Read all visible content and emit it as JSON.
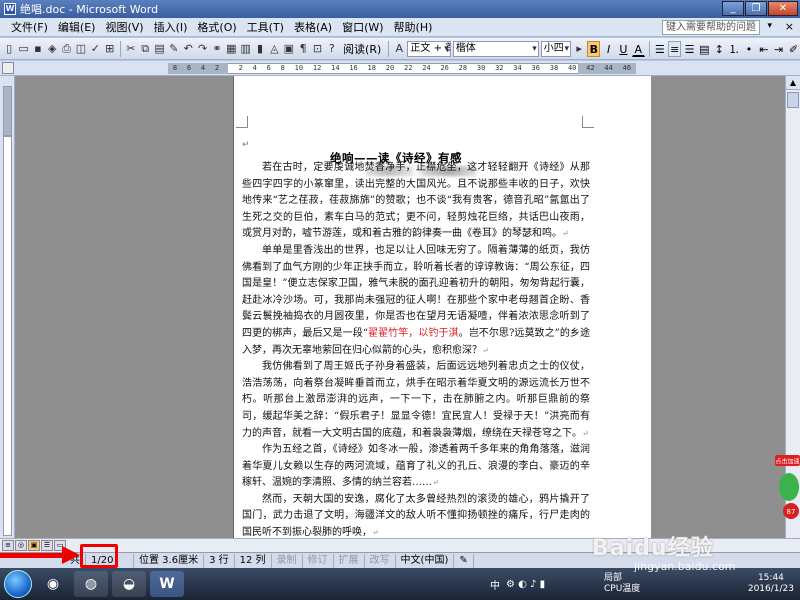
{
  "window": {
    "title": "绝唱.doc - Microsoft Word",
    "app_icon": "W",
    "controls": [
      "minimize",
      "maximize",
      "close"
    ]
  },
  "menubar": {
    "items": [
      "文件(F)",
      "编辑(E)",
      "视图(V)",
      "插入(I)",
      "格式(O)",
      "工具(T)",
      "表格(A)",
      "窗口(W)",
      "帮助(H)"
    ],
    "help_placeholder": "键入需要帮助的问题",
    "close_glyph": "×"
  },
  "toolbar": {
    "read_label": "阅读(R)",
    "style_value": "正文 + 首行",
    "font_value": "楷体",
    "size_value": "小四",
    "bold": "B",
    "italic": "I",
    "underline": "U",
    "font_color_letter": "A"
  },
  "ruler": {
    "numbers": [
      "8",
      "6",
      "4",
      "2",
      "",
      "2",
      "4",
      "6",
      "8",
      "10",
      "12",
      "14",
      "16",
      "18",
      "20",
      "22",
      "24",
      "26",
      "28",
      "30",
      "32",
      "34",
      "36",
      "38",
      "40",
      "42",
      "44",
      "46"
    ]
  },
  "document": {
    "title": "绝响——读《诗经》有感",
    "paragraphs": [
      {
        "runs": [
          {
            "t": "若在古时，定要虔诚地焚香净手，正襟危坐，这才轻轻翻开《诗经》从那些四字四字的小篆窜里，读出完整的大国风光。且不说那些丰收的日子，欢快地传来“艺之荏菽，荏菽旆旆”的赞歌；也不谈“我有贵客，德音孔昭”氤氲出了生死之交的巨伯，素车白马的范式；更不问，轻剪烛花巨络，共话巴山夜雨，或赏月对酌，嘘节游莲，或和着古雅的韵律奏一曲《卷耳》的琴瑟和鸣。"
          }
        ]
      },
      {
        "runs": [
          {
            "t": "单单是里香浅出的世界，也足以让人回味无穷了。隔着薄薄的纸页，我仿佛看到了血气方刚的少年正挟手而立，聆听着长者的谆谆教诲：“周公东征，四国是皇！”便立志保家卫国，雅气未脱的面孔迎着初升的朝阳，匆匆背起行囊，赶赴冰冷沙场。可，我那尚未强冠的征人啊！在那些个家中老母翘首企盼、香鬓云鬟挽袖捣衣的月圆夜里，你是否也在望月无语凝噎，伴着浓浓思念听到了四更的梆声，最后又是一段“"
          },
          {
            "t": "翟翟竹竿，以钓于淇",
            "red": true
          },
          {
            "t": "。岂不尔思?远莫致之”的乡途入梦，再次无辜地萦回在归心似箭的心头，愈积愈深？"
          }
        ]
      },
      {
        "runs": [
          {
            "t": "我仿佛看到了周王姬氏子孙身着盛装，后面远远地列着忠贞之士的仪仗，浩浩荡荡，向着祭台凝眸垂首而立，烘手在昭示着华夏文明的源远流长万世不朽。听那台上激昂澎湃的远声，一下一下，击在肺腑之内。听那巨鼎前的祭司，缓起华美之辞：“假乐君子！显显令德！宜民宜人！受禄于天！”洪亮而有力的声音，就看一大文明古国的底蕴，和着袅袅薄烟，缭绕在天禄苍穹之下。"
          }
        ]
      },
      {
        "runs": [
          {
            "t": "作为五经之首，《诗经》如冬冰一般，渗透着两千多年来的角角落落，滋润着华夏儿女赖以生存的两河流域，蕴育了礼义的孔丘、浪漫的李白、豪迈的辛稼轩、温婉的李清照、多情的纳兰容若……"
          }
        ]
      },
      {
        "runs": [
          {
            "t": "然而，天朝大国的安逸，腐化了太多曾经热烈的滚烫的雄心，鸦片撬开了国门，武力击退了文明，海疆洋文的敌人听不懂抑扬顿挫的痛斥，行尸走肉的国民听不到振心裂肺的呼唤，"
          }
        ]
      }
    ]
  },
  "status": {
    "page": "共",
    "page_of": "1/20",
    "position": "位置 3.6厘米",
    "line": "3 行",
    "col": "12 列",
    "modes": [
      "录制",
      "修订",
      "扩展",
      "改写"
    ],
    "language": "中文(中国)"
  },
  "taskbar": {
    "tray_ime": "中",
    "cpu_label": "CPU温度",
    "cpu_value": "局部",
    "time": "15:44",
    "date": "2016/1/23"
  },
  "watermark": {
    "text": "Baidu经验",
    "sub": "jingyan.baidu.com"
  },
  "addon": {
    "badge": "点击加速",
    "value": "87"
  },
  "colors": {
    "title_bar": "#3a5f9f",
    "highlight_red": "#e00000",
    "bold_active": "#f9c870"
  }
}
